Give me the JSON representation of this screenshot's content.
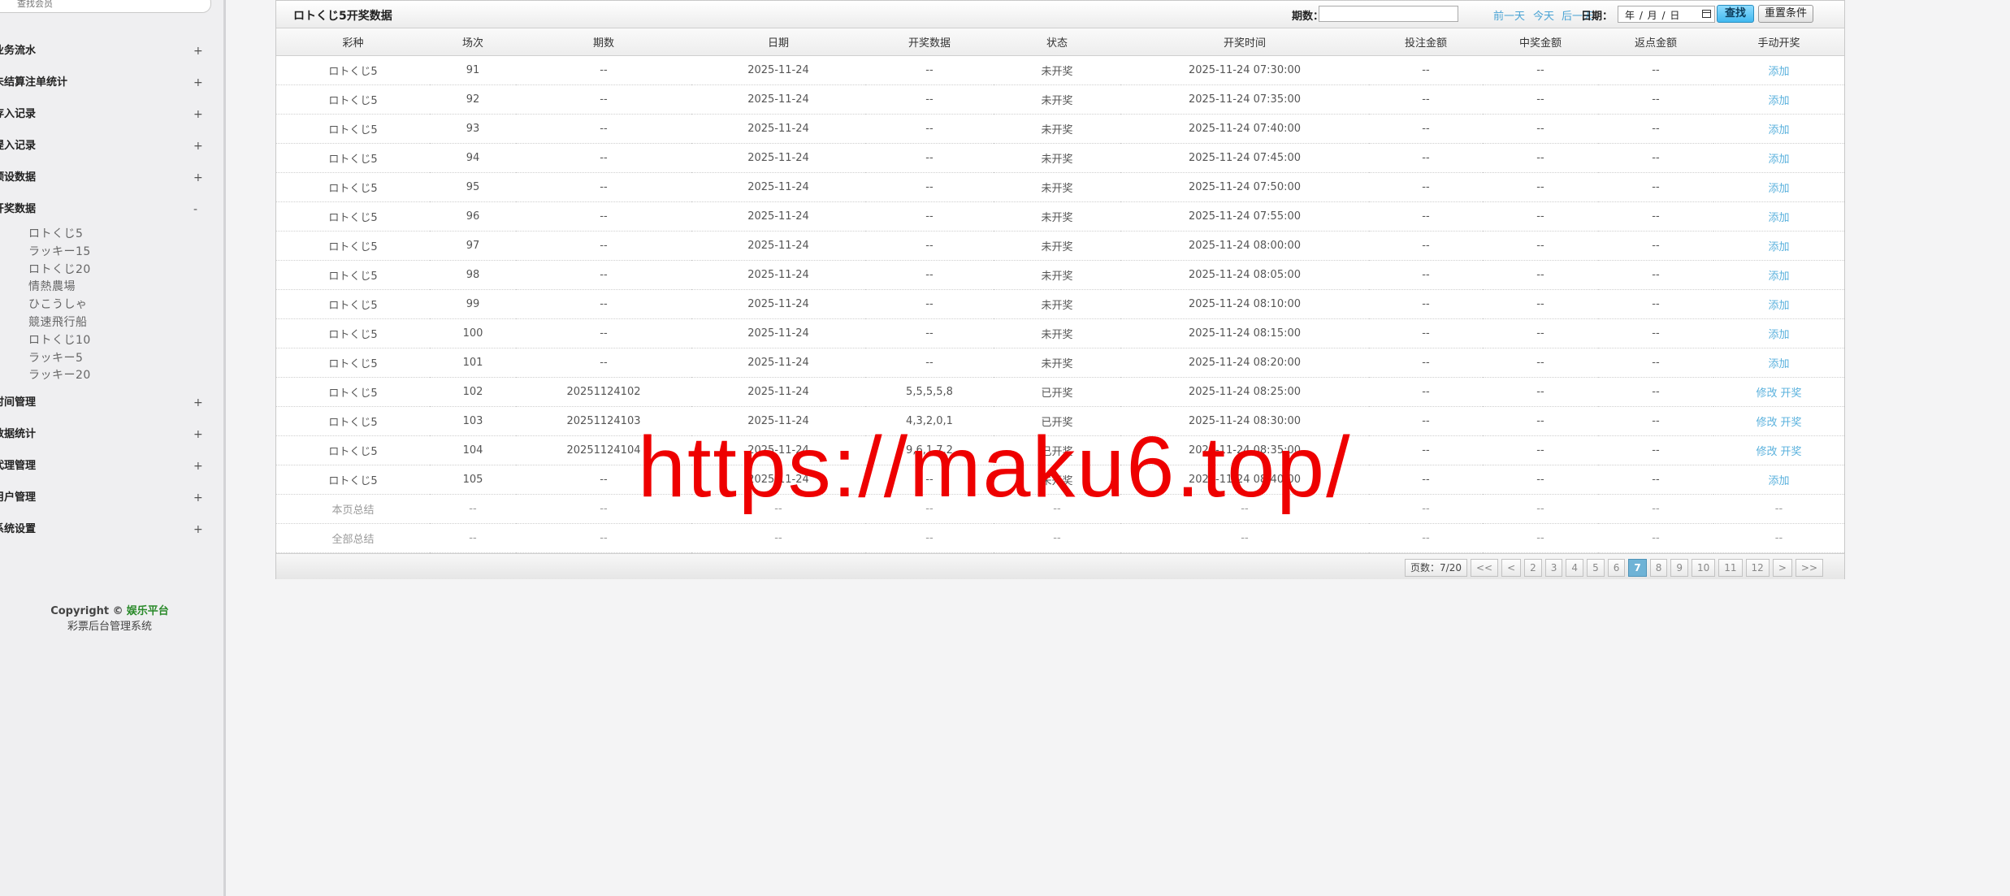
{
  "sidebar": {
    "search_placeholder": "查找会员",
    "menu": [
      {
        "label": "业务流水",
        "toggle": "+"
      },
      {
        "label": "未结算注单统计",
        "toggle": "+"
      },
      {
        "label": "存入记录",
        "toggle": "+"
      },
      {
        "label": "提入记录",
        "toggle": "+"
      },
      {
        "label": "预设数据",
        "toggle": "+"
      },
      {
        "label": "开奖数据",
        "toggle": "-"
      },
      {
        "label": "时间管理",
        "toggle": "+"
      },
      {
        "label": "数据统计",
        "toggle": "+"
      },
      {
        "label": "代理管理",
        "toggle": "+"
      },
      {
        "label": "用户管理",
        "toggle": "+"
      },
      {
        "label": "系统设置",
        "toggle": "+"
      }
    ],
    "sub_items": [
      "ロトくじ5",
      "ラッキー15",
      "ロトくじ20",
      "情熱農場",
      "ひこうしゃ",
      "競速飛行船",
      "ロトくじ10",
      "ラッキー5",
      "ラッキー20"
    ],
    "copyright_prefix": "Copyright ©",
    "copyright_brand": "娱乐平台",
    "copyright_sub": "彩票后台管理系统"
  },
  "panel": {
    "title": "ロトくじ5开奖数据",
    "issue_label": "期数：",
    "issue_value": "",
    "prev_day": "前一天",
    "today": "今天",
    "next_day": "后一天",
    "date_label": "日期：",
    "date_placeholder": "年 / 月 / 日",
    "search_btn": "查找",
    "reset_btn": "重置条件"
  },
  "table": {
    "columns": [
      "彩种",
      "场次",
      "期数",
      "日期",
      "开奖数据",
      "状态",
      "开奖时间",
      "投注金额",
      "中奖金额",
      "返点金额",
      "手动开奖"
    ],
    "rows": [
      [
        "ロトくじ5",
        "91",
        "--",
        "2025-11-24",
        "--",
        "未开奖",
        "2025-11-24 07:30:00",
        "--",
        "--",
        "--",
        "添加"
      ],
      [
        "ロトくじ5",
        "92",
        "--",
        "2025-11-24",
        "--",
        "未开奖",
        "2025-11-24 07:35:00",
        "--",
        "--",
        "--",
        "添加"
      ],
      [
        "ロトくじ5",
        "93",
        "--",
        "2025-11-24",
        "--",
        "未开奖",
        "2025-11-24 07:40:00",
        "--",
        "--",
        "--",
        "添加"
      ],
      [
        "ロトくじ5",
        "94",
        "--",
        "2025-11-24",
        "--",
        "未开奖",
        "2025-11-24 07:45:00",
        "--",
        "--",
        "--",
        "添加"
      ],
      [
        "ロトくじ5",
        "95",
        "--",
        "2025-11-24",
        "--",
        "未开奖",
        "2025-11-24 07:50:00",
        "--",
        "--",
        "--",
        "添加"
      ],
      [
        "ロトくじ5",
        "96",
        "--",
        "2025-11-24",
        "--",
        "未开奖",
        "2025-11-24 07:55:00",
        "--",
        "--",
        "--",
        "添加"
      ],
      [
        "ロトくじ5",
        "97",
        "--",
        "2025-11-24",
        "--",
        "未开奖",
        "2025-11-24 08:00:00",
        "--",
        "--",
        "--",
        "添加"
      ],
      [
        "ロトくじ5",
        "98",
        "--",
        "2025-11-24",
        "--",
        "未开奖",
        "2025-11-24 08:05:00",
        "--",
        "--",
        "--",
        "添加"
      ],
      [
        "ロトくじ5",
        "99",
        "--",
        "2025-11-24",
        "--",
        "未开奖",
        "2025-11-24 08:10:00",
        "--",
        "--",
        "--",
        "添加"
      ],
      [
        "ロトくじ5",
        "100",
        "--",
        "2025-11-24",
        "--",
        "未开奖",
        "2025-11-24 08:15:00",
        "--",
        "--",
        "--",
        "添加"
      ],
      [
        "ロトくじ5",
        "101",
        "--",
        "2025-11-24",
        "--",
        "未开奖",
        "2025-11-24 08:20:00",
        "--",
        "--",
        "--",
        "添加"
      ],
      [
        "ロトくじ5",
        "102",
        "20251124102",
        "2025-11-24",
        "5,5,5,5,8",
        "已开奖",
        "2025-11-24 08:25:00",
        "--",
        "--",
        "--",
        "修改 开奖"
      ],
      [
        "ロトくじ5",
        "103",
        "20251124103",
        "2025-11-24",
        "4,3,2,0,1",
        "已开奖",
        "2025-11-24 08:30:00",
        "--",
        "--",
        "--",
        "修改 开奖"
      ],
      [
        "ロトくじ5",
        "104",
        "20251124104",
        "2025-11-24",
        "9,6,1,7,2",
        "已开奖",
        "2025-11-24 08:35:00",
        "--",
        "--",
        "--",
        "修改 开奖"
      ],
      [
        "ロトくじ5",
        "105",
        "--",
        "2025-11-24",
        "--",
        "未开奖",
        "2025-11-24 08:40:00",
        "--",
        "--",
        "--",
        "添加"
      ]
    ],
    "summary_rows": [
      [
        "本页总结",
        "--",
        "--",
        "--",
        "--",
        "--",
        "--",
        "--",
        "--",
        "--",
        "--"
      ],
      [
        "全部总结",
        "--",
        "--",
        "--",
        "--",
        "--",
        "--",
        "--",
        "--",
        "--",
        "--"
      ]
    ]
  },
  "pager": {
    "info": "页数：7/20",
    "first": "<<",
    "prev": "<",
    "pages": [
      "2",
      "3",
      "4",
      "5",
      "6",
      "7",
      "8",
      "9",
      "10",
      "11",
      "12"
    ],
    "current": "7",
    "next": ">",
    "last": ">>"
  },
  "watermark": "https://maku6.top/",
  "colors": {
    "link": "#5ab1dd",
    "active_page": "#6fb3d6",
    "watermark": "#ee0000",
    "brand": "#2a8a2a"
  }
}
